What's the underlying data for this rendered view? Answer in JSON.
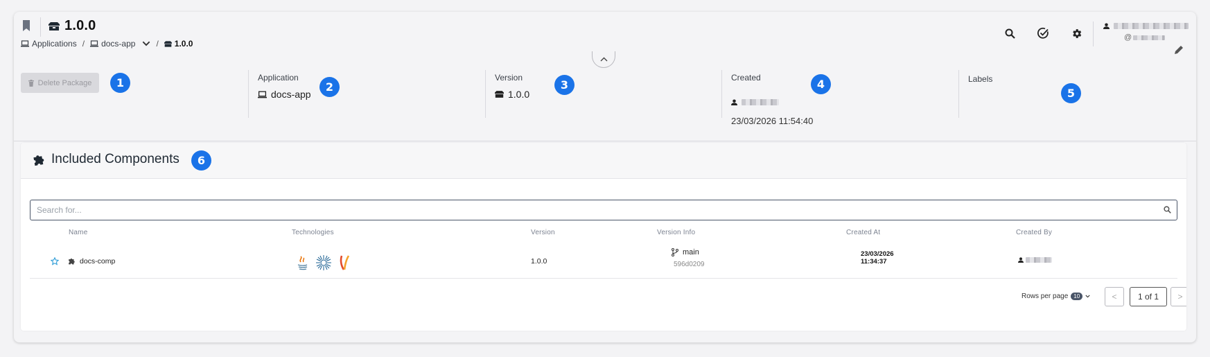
{
  "header": {
    "title": "1.0.0",
    "breadcrumb": [
      {
        "label": "Applications"
      },
      {
        "label": "docs-app"
      },
      {
        "label": "1.0.0"
      }
    ],
    "user_handle_prefix": "@"
  },
  "info": {
    "delete_label": "Delete Package",
    "application_label": "Application",
    "application_value": "docs-app",
    "version_label": "Version",
    "version_value": "1.0.0",
    "created_label": "Created",
    "created_date": "23/03/2026 11:54:40",
    "labels_label": "Labels"
  },
  "markers": [
    "1",
    "2",
    "3",
    "4",
    "5",
    "6"
  ],
  "components": {
    "title": "Included Components",
    "search_placeholder": "Search for...",
    "columns": [
      "Name",
      "Technologies",
      "Version",
      "Version Info",
      "Created At",
      "Created By"
    ],
    "rows": [
      {
        "name": "docs-comp",
        "technologies": [
          "java-icon",
          "helm-icon",
          "maven-icon"
        ],
        "version": "1.0.0",
        "branch": "main",
        "commit": "596d0209",
        "created_date": "23/03/2026",
        "created_time": "11:34:37"
      }
    ],
    "rows_per_page_label": "Rows per page",
    "rows_per_page_value": "10",
    "page_indicator": "1 of 1",
    "prev_label": "<",
    "next_label": ">"
  },
  "colors": {
    "accent": "#1a73e8",
    "star": "#2b9bd6"
  }
}
